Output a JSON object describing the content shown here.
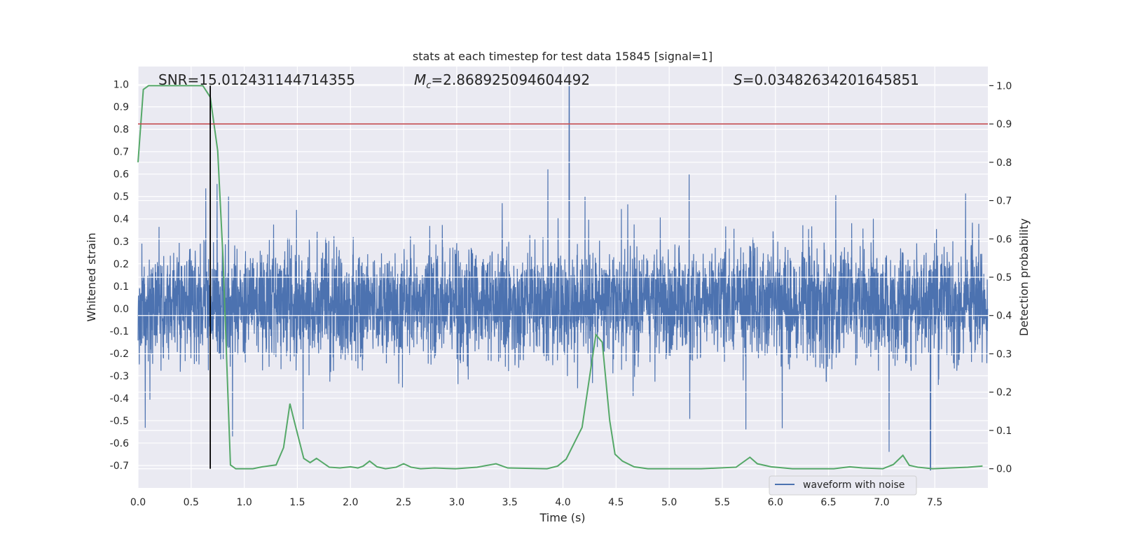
{
  "chart_data": {
    "type": "line",
    "title": "stats at each timestep for test data 15845 [signal=1]",
    "xlabel": "Time (s)",
    "ylabel": "Whitened strain",
    "ylabel_right": "Detection probability",
    "xlim": [
      0,
      8.0
    ],
    "ylim": [
      -0.8,
      1.08
    ],
    "ylim_right": [
      -0.05,
      1.05
    ],
    "xticks": [
      "0.0",
      "0.5",
      "1.0",
      "1.5",
      "2.0",
      "2.5",
      "3.0",
      "3.5",
      "4.0",
      "4.5",
      "5.0",
      "5.5",
      "6.0",
      "6.5",
      "7.0",
      "7.5"
    ],
    "yticks": [
      "1.0",
      "0.9",
      "0.8",
      "0.7",
      "0.6",
      "0.5",
      "0.4",
      "0.3",
      "0.2",
      "0.1",
      "0.0",
      "-0.1",
      "-0.2",
      "-0.3",
      "-0.4",
      "-0.5",
      "-0.6",
      "-0.7"
    ],
    "yticks_right": [
      "1.0",
      "0.9",
      "0.8",
      "0.7",
      "0.6",
      "0.5",
      "0.4",
      "0.3",
      "0.2",
      "0.1",
      "0.0"
    ],
    "grid": true,
    "background": "#eaeaf2",
    "legend": {
      "placement": "lower-right",
      "entries": [
        "waveform with noise"
      ]
    },
    "annotations": {
      "snr": "SNR=15.012431144714355",
      "mc_symbol": "M",
      "mc_sub": "c",
      "mc_value": "=2.868925094604492",
      "s_symbol": "S",
      "s_value": "=0.03482634201645851"
    },
    "series": [
      {
        "name": "waveform with noise",
        "color": "#4c72b0",
        "axis": "left",
        "typical_range": [
          -0.3,
          0.3
        ],
        "max_spike": {
          "x": 4.06,
          "y": 1.0
        },
        "min_spike": {
          "x": 7.46,
          "y": -0.72
        }
      },
      {
        "color": "#55a868",
        "axis": "right",
        "x": [
          0,
          0.05,
          0.1,
          0.61,
          0.68,
          0.75,
          0.8,
          0.87,
          0.92,
          1.08,
          1.17,
          1.3,
          1.37,
          1.43,
          1.47,
          1.56,
          1.62,
          1.68,
          1.8,
          1.9,
          2.0,
          2.07,
          2.12,
          2.18,
          2.25,
          2.33,
          2.43,
          2.5,
          2.57,
          2.66,
          2.79,
          2.99,
          3.19,
          3.37,
          3.48,
          3.85,
          3.95,
          4.03,
          4.18,
          4.31,
          4.37,
          4.44,
          4.49,
          4.56,
          4.67,
          4.8,
          5.3,
          5.63,
          5.76,
          5.83,
          5.96,
          6.16,
          6.55,
          6.7,
          6.82,
          7.01,
          7.11,
          7.2,
          7.26,
          7.34,
          7.48,
          7.81,
          7.95
        ],
        "y": [
          0.8,
          0.99,
          1.0,
          1.0,
          0.97,
          0.83,
          0.55,
          0.01,
          0.0,
          0.0,
          0.005,
          0.01,
          0.055,
          0.17,
          0.125,
          0.027,
          0.016,
          0.027,
          0.004,
          0.002,
          0.005,
          0.002,
          0.007,
          0.02,
          0.005,
          0.0,
          0.004,
          0.013,
          0.004,
          0.0,
          0.002,
          0.0,
          0.004,
          0.013,
          0.002,
          0.0,
          0.007,
          0.025,
          0.108,
          0.35,
          0.33,
          0.126,
          0.038,
          0.02,
          0.005,
          0.0,
          0.0,
          0.004,
          0.03,
          0.013,
          0.005,
          0.0,
          0.0,
          0.005,
          0.002,
          0.0,
          0.011,
          0.035,
          0.009,
          0.004,
          0.0,
          0.004,
          0.007
        ]
      },
      {
        "color": "#c44e52",
        "axis": "right",
        "type": "hline",
        "y": 0.9
      },
      {
        "color": "#000000",
        "axis": "right",
        "type": "vline",
        "x": 0.68,
        "range": [
          0,
          1.0
        ]
      }
    ]
  }
}
